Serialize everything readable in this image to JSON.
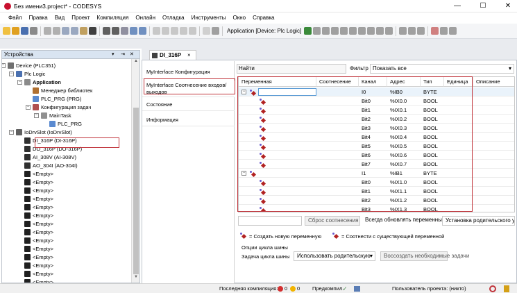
{
  "window": {
    "title": "Без имени3.project* - CODESYS",
    "controls": [
      "minimize-icon",
      "maximize-icon",
      "close-icon"
    ]
  },
  "menu": [
    "Файл",
    "Правка",
    "Вид",
    "Проект",
    "Компиляция",
    "Онлайн",
    "Отладка",
    "Инструменты",
    "Окно",
    "Справка"
  ],
  "toolbar": {
    "active_application": "Application [Device: Plc Logic]"
  },
  "devices_pane": {
    "title": "Устройства",
    "header_buttons": [
      "▾",
      "⇥",
      "✕"
    ],
    "tree": [
      {
        "label": "Device (PLC351)",
        "level": 0,
        "icon": "device-icon",
        "expand": "−"
      },
      {
        "label": "Plc Logic",
        "level": 1,
        "icon": "plc-logic-icon",
        "expand": "−"
      },
      {
        "label": "Application",
        "level": 2,
        "icon": "application-icon",
        "expand": "−",
        "bold": true
      },
      {
        "label": "Менеджер библиотек",
        "level": 3,
        "icon": "library-manager-icon"
      },
      {
        "label": "PLC_PRG (PRG)",
        "level": 3,
        "icon": "program-icon"
      },
      {
        "label": "Конфигурация задач",
        "level": 3,
        "icon": "task-config-icon",
        "expand": "−"
      },
      {
        "label": "MainTask",
        "level": 4,
        "icon": "task-icon",
        "expand": "−"
      },
      {
        "label": "PLC_PRG",
        "level": 5,
        "icon": "program-call-icon"
      },
      {
        "label": "IoDrvSlot (IoDrvSlot)",
        "level": 1,
        "icon": "slot-icon",
        "expand": "−"
      },
      {
        "label": "DI_316P (DI-316P)",
        "level": 2,
        "icon": "module-icon",
        "selected": true
      },
      {
        "label": "DO_316P (DO-316P)",
        "level": 2,
        "icon": "module-icon"
      },
      {
        "label": "AI_308V (AI-308V)",
        "level": 2,
        "icon": "module-icon"
      },
      {
        "label": "AO_304I (AO-304I)",
        "level": 2,
        "icon": "module-icon"
      },
      {
        "label": "<Empty>",
        "level": 2,
        "icon": "empty-slot-icon"
      },
      {
        "label": "<Empty>",
        "level": 2,
        "icon": "empty-slot-icon"
      },
      {
        "label": "<Empty>",
        "level": 2,
        "icon": "empty-slot-icon"
      },
      {
        "label": "<Empty>",
        "level": 2,
        "icon": "empty-slot-icon"
      },
      {
        "label": "<Empty>",
        "level": 2,
        "icon": "empty-slot-icon"
      },
      {
        "label": "<Empty>",
        "level": 2,
        "icon": "empty-slot-icon"
      },
      {
        "label": "<Empty>",
        "level": 2,
        "icon": "empty-slot-icon"
      },
      {
        "label": "<Empty>",
        "level": 2,
        "icon": "empty-slot-icon"
      },
      {
        "label": "<Empty>",
        "level": 2,
        "icon": "empty-slot-icon"
      },
      {
        "label": "<Empty>",
        "level": 2,
        "icon": "empty-slot-icon"
      },
      {
        "label": "<Empty>",
        "level": 2,
        "icon": "empty-slot-icon"
      },
      {
        "label": "<Empty>",
        "level": 2,
        "icon": "empty-slot-icon"
      },
      {
        "label": "<Empty>",
        "level": 2,
        "icon": "empty-slot-icon"
      },
      {
        "label": "<Empty>",
        "level": 2,
        "icon": "empty-slot-icon"
      }
    ]
  },
  "editor": {
    "tab_label": "DI_316P",
    "tab_close": "×",
    "nav": [
      {
        "label": "MyInterface Конфигурация"
      },
      {
        "label": "MyInterface Соотнесение входов/выходов",
        "active": true
      },
      {
        "label": "Состояние"
      },
      {
        "label": "Информация"
      }
    ],
    "find_label": "Найти",
    "filter_label": "Фильтр",
    "filter_value": "Показать все",
    "columns": [
      "Переменная",
      "Соотнесение",
      "Канал",
      "Адрес",
      "Тип",
      "Единица",
      "Описание"
    ],
    "rows": [
      {
        "expand": "−",
        "channel": "I0",
        "address": "%IB0",
        "type": "BYTE",
        "selected": true
      },
      {
        "channel": "Bit0",
        "address": "%IX0.0",
        "type": "BOOL"
      },
      {
        "channel": "Bit1",
        "address": "%IX0.1",
        "type": "BOOL"
      },
      {
        "channel": "Bit2",
        "address": "%IX0.2",
        "type": "BOOL"
      },
      {
        "channel": "Bit3",
        "address": "%IX0.3",
        "type": "BOOL"
      },
      {
        "channel": "Bit4",
        "address": "%IX0.4",
        "type": "BOOL"
      },
      {
        "channel": "Bit5",
        "address": "%IX0.5",
        "type": "BOOL"
      },
      {
        "channel": "Bit6",
        "address": "%IX0.6",
        "type": "BOOL"
      },
      {
        "channel": "Bit7",
        "address": "%IX0.7",
        "type": "BOOL"
      },
      {
        "expand": "−",
        "channel": "I1",
        "address": "%IB1",
        "type": "BYTE"
      },
      {
        "channel": "Bit0",
        "address": "%IX1.0",
        "type": "BOOL"
      },
      {
        "channel": "Bit1",
        "address": "%IX1.1",
        "type": "BOOL"
      },
      {
        "channel": "Bit2",
        "address": "%IX1.2",
        "type": "BOOL"
      },
      {
        "channel": "Bit3",
        "address": "%IX1.3",
        "type": "BOOL"
      }
    ],
    "reset_mapping_button": "Сброс соотнесения",
    "always_update_label": "Всегда обновлять переменные",
    "parent_setting": "Установка родительского уст",
    "legend_create": "= Создать новую переменную",
    "legend_map": "= Соотнести с существующей переменной",
    "bus_cycle_group": "Опции цикла шины",
    "bus_cycle_task_label": "Задача цикла шины",
    "bus_cycle_task_value": "Использовать родительскую",
    "create_tasks_button": "Воссоздать необходимые задачи"
  },
  "status_bar": {
    "last_build": "Последняя компиляция:",
    "errors": "0",
    "warnings": "0",
    "precompile": "Предкомпил.",
    "precompile_ok": "✓",
    "project_user": "Пользователь проекта: (никто)"
  },
  "colors": {
    "accent": "#c0333a",
    "selection": "#cce4f7",
    "pane_header": "#d9e4f1"
  }
}
